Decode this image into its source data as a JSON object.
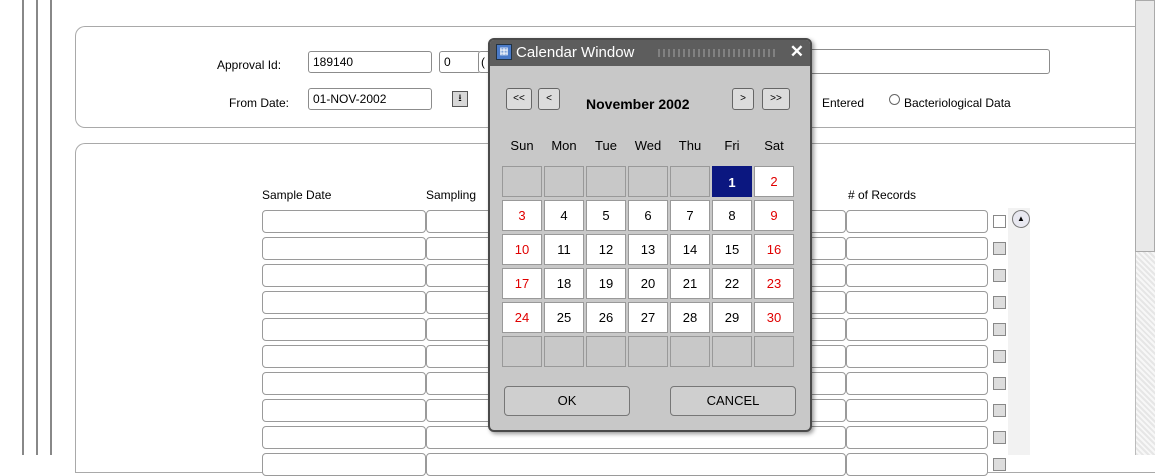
{
  "form": {
    "approval_id_label": "Approval Id:",
    "approval_id_value": "189140",
    "approval_seq_value": "0",
    "approval_extra_value": "(",
    "from_date_label": "From Date:",
    "from_date_value": "01-NOV-2002",
    "radio_entered_label": "Entered",
    "radio_bacteriological_label": "Bacteriological Data"
  },
  "table": {
    "col_sample_date": "Sample Date",
    "col_sampling": "Sampling",
    "col_records": "# of Records"
  },
  "calendar": {
    "title": "Calendar Window",
    "month_label": "November 2002",
    "nav_prev_year": "<<",
    "nav_prev_month": "<",
    "nav_next_month": ">",
    "nav_next_year": ">>",
    "day_headers": [
      "Sun",
      "Mon",
      "Tue",
      "Wed",
      "Thu",
      "Fri",
      "Sat"
    ],
    "weeks": [
      [
        "",
        "",
        "",
        "",
        "",
        "1",
        "2"
      ],
      [
        "3",
        "4",
        "5",
        "6",
        "7",
        "8",
        "9"
      ],
      [
        "10",
        "11",
        "12",
        "13",
        "14",
        "15",
        "16"
      ],
      [
        "17",
        "18",
        "19",
        "20",
        "21",
        "22",
        "23"
      ],
      [
        "24",
        "25",
        "26",
        "27",
        "28",
        "29",
        "30"
      ],
      [
        "",
        "",
        "",
        "",
        "",
        "",
        ""
      ]
    ],
    "selected_day": "1",
    "ok_label": "OK",
    "cancel_label": "CANCEL"
  },
  "colors": {
    "selected_day_bg": "#0b1780",
    "weekend_text": "#e00000",
    "title_bar": "#5d5d5d"
  }
}
